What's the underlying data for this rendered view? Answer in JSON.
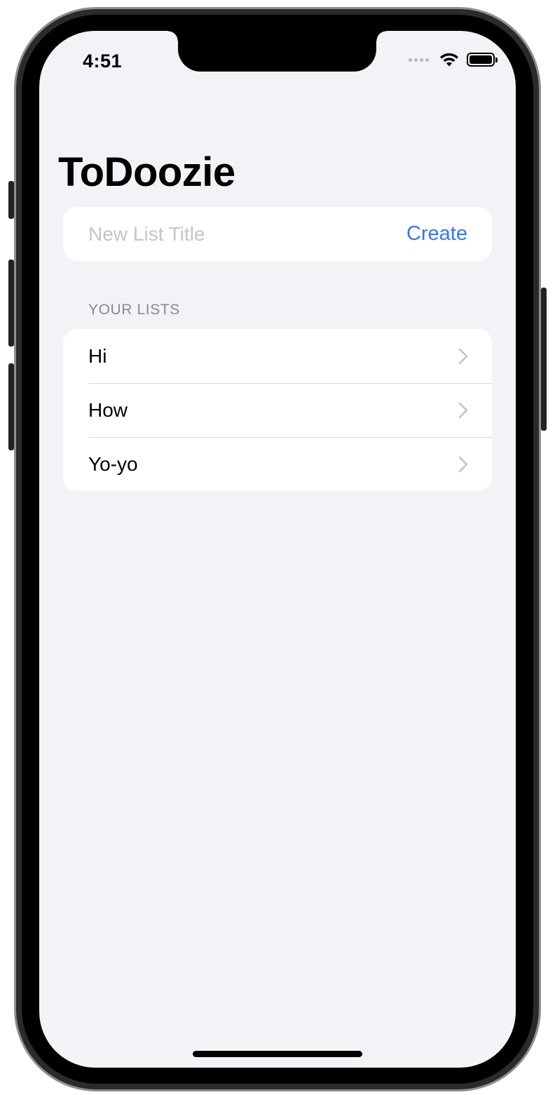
{
  "status_bar": {
    "time": "4:51",
    "icons": [
      "signal-dots-icon",
      "wifi-icon",
      "battery-icon"
    ],
    "battery_level": 1.0
  },
  "nav": {
    "title": "ToDoozie"
  },
  "new_list": {
    "placeholder": "New List Title",
    "value": "",
    "create_label": "Create"
  },
  "lists_section": {
    "header": "YOUR LISTS",
    "items": [
      {
        "label": "Hi"
      },
      {
        "label": "How"
      },
      {
        "label": "Yo-yo"
      }
    ]
  },
  "colors": {
    "accent": "#3478f6",
    "background": "#f2f2f7",
    "card": "#ffffff",
    "secondary_text": "#8a8a8e",
    "placeholder_text": "#c5c5c7"
  }
}
